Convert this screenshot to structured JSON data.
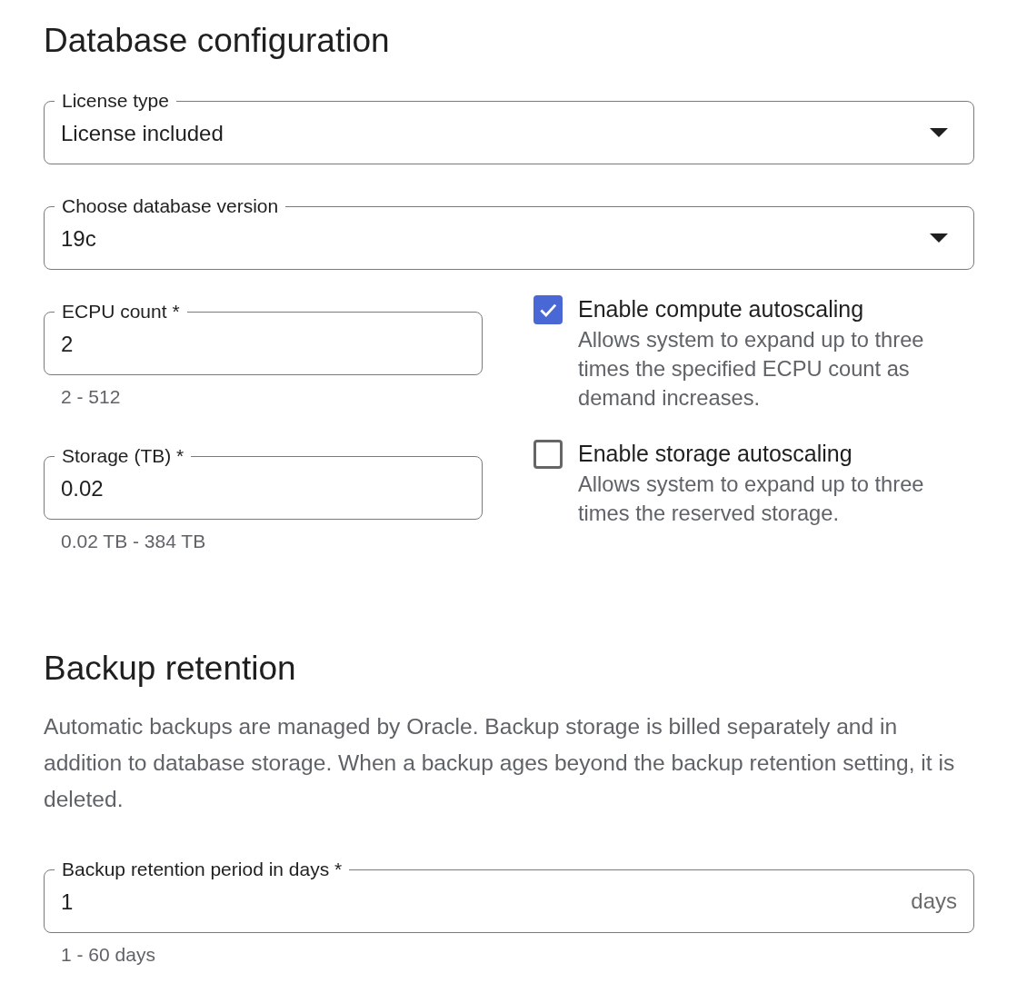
{
  "title": "Database configuration",
  "fields": [
    {
      "kind": "dropdown",
      "label": "License type",
      "value": "License included"
    },
    {
      "kind": "dropdown",
      "label": "Choose database version",
      "value": "19c"
    }
  ],
  "options": [
    {
      "field": {
        "label": "ECPU count *",
        "value": "2",
        "hint": "2 - 512"
      },
      "checkbox": {
        "label": "Enable compute autoscaling",
        "description": "Allows system to expand up to three times the specified ECPU count as demand increases.",
        "checked": true
      }
    },
    {
      "field": {
        "label": "Storage (TB) *",
        "value": "0.02",
        "hint": "0.02 TB - 384 TB"
      },
      "checkbox": {
        "label": "Enable storage autoscaling",
        "description": "Allows system to expand up to three times the reserved storage.",
        "checked": false
      }
    }
  ],
  "backup": {
    "title": "Backup retention",
    "description": "Automatic backups are managed by Oracle. Backup storage is billed separately and in addition to database storage. When a backup ages beyond the backup retention setting, it is deleted.",
    "field": {
      "label": "Backup retention period in days *",
      "value": "1",
      "suffix": "days",
      "hint": "1 - 60 days"
    }
  }
}
